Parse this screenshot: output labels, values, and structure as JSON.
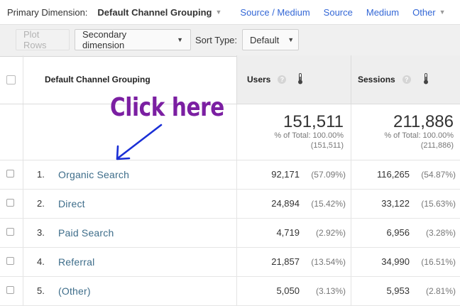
{
  "dimension_bar": {
    "label": "Primary Dimension:",
    "active": "Default Channel Grouping",
    "links": [
      "Source / Medium",
      "Source",
      "Medium",
      "Other"
    ]
  },
  "toolbar": {
    "plot_rows": "Plot Rows",
    "secondary_dimension": "Secondary dimension",
    "sort_type_label": "Sort Type:",
    "sort_type_value": "Default"
  },
  "table": {
    "columns": {
      "dimension": "Default Channel Grouping",
      "users": "Users",
      "sessions": "Sessions"
    },
    "totals": {
      "users": "151,511",
      "users_pct": "% of Total: 100.00%",
      "users_sub": "(151,511)",
      "sessions": "211,886",
      "sessions_pct": "% of Total: 100.00%",
      "sessions_sub": "(211,886)"
    },
    "rows": [
      {
        "rank": "1.",
        "channel": "Organic Search",
        "users": "92,171",
        "users_pct": "(57.09%)",
        "sessions": "116,265",
        "sessions_pct": "(54.87%)"
      },
      {
        "rank": "2.",
        "channel": "Direct",
        "users": "24,894",
        "users_pct": "(15.42%)",
        "sessions": "33,122",
        "sessions_pct": "(15.63%)"
      },
      {
        "rank": "3.",
        "channel": "Paid Search",
        "users": "4,719",
        "users_pct": "(2.92%)",
        "sessions": "6,956",
        "sessions_pct": "(3.28%)"
      },
      {
        "rank": "4.",
        "channel": "Referral",
        "users": "21,857",
        "users_pct": "(13.54%)",
        "sessions": "34,990",
        "sessions_pct": "(16.51%)"
      },
      {
        "rank": "5.",
        "channel": "(Other)",
        "users": "5,050",
        "users_pct": "(3.13%)",
        "sessions": "5,953",
        "sessions_pct": "(2.81%)"
      }
    ]
  },
  "annotation": {
    "text": "Click here",
    "color": "#7b1fa2",
    "arrow_color": "#1a2fd6"
  },
  "colors": {
    "link": "#3367d6",
    "row_link": "#3e6d8a",
    "header_bg": "#eeeeee"
  },
  "icons": [
    "help-icon",
    "thermometer-icon",
    "dropdown-caret-icon",
    "arrow-annotation-icon"
  ]
}
